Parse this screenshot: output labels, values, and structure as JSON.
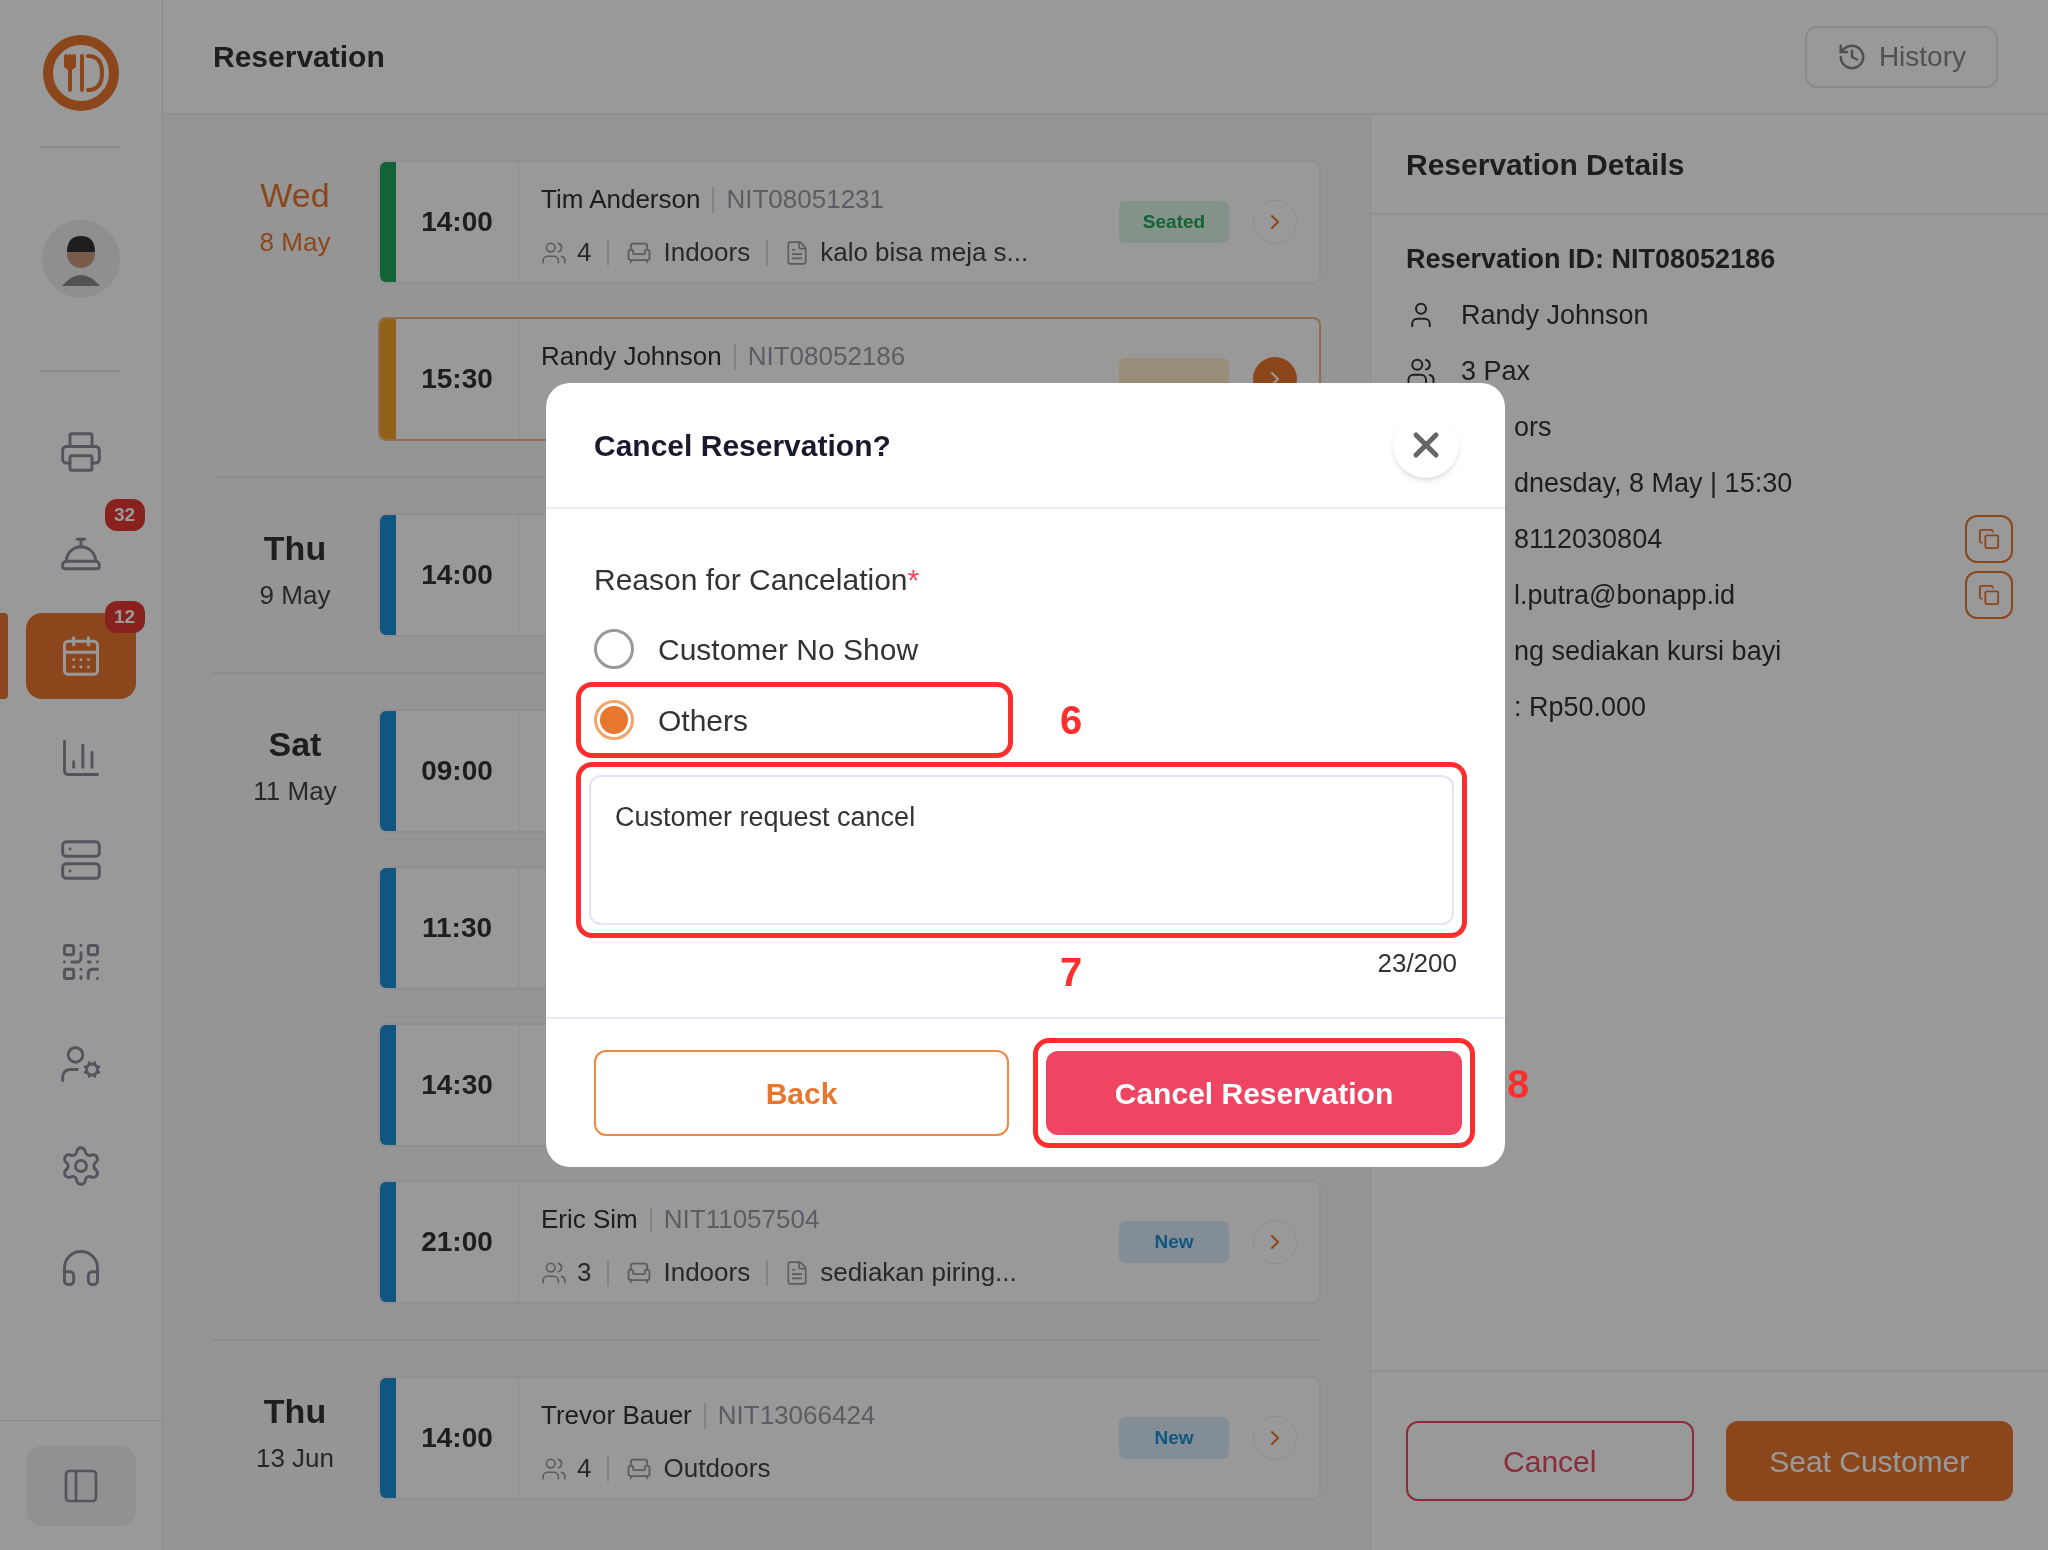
{
  "header": {
    "title": "Reservation",
    "history_button": "History"
  },
  "sidebar": {
    "items": [
      {
        "selected": false
      },
      {
        "badge": "32",
        "selected": false
      },
      {
        "badge": "12",
        "selected": true
      },
      {
        "selected": false
      },
      {
        "selected": false
      },
      {
        "selected": false
      },
      {
        "selected": false
      },
      {
        "selected": false
      },
      {
        "selected": false
      }
    ]
  },
  "days": [
    {
      "weekday": "Wed",
      "date": "8 May",
      "selected": true,
      "reservations": [
        {
          "time": "14:00",
          "kind": "seated",
          "selected": false,
          "name": "Tim Anderson",
          "id": "NIT08051231",
          "guests": "4",
          "seating": "Indoors",
          "note": "kalo bisa meja s...",
          "badge": "Seated"
        },
        {
          "time": "15:30",
          "kind": "accepted",
          "selected": true,
          "name": "Randy Johnson",
          "id": "NIT08052186"
        }
      ]
    },
    {
      "weekday": "Thu",
      "date": "9 May",
      "selected": false,
      "reservations": [
        {
          "time": "14:00",
          "kind": "new",
          "selected": false
        }
      ]
    },
    {
      "weekday": "Sat",
      "date": "11 May",
      "selected": false,
      "reservations": [
        {
          "time": "09:00",
          "kind": "new",
          "selected": false
        },
        {
          "time": "11:30",
          "kind": "new",
          "selected": false
        },
        {
          "time": "14:30",
          "kind": "new",
          "selected": false
        },
        {
          "time": "21:00",
          "kind": "new",
          "selected": false,
          "name": "Eric Sim",
          "id": "NIT11057504",
          "guests": "3",
          "seating": "Indoors",
          "note": "sediakan piring...",
          "badge": "New"
        }
      ]
    },
    {
      "weekday": "Thu",
      "date": "13 Jun",
      "selected": false,
      "reservations": [
        {
          "time": "14:00",
          "kind": "new",
          "selected": false,
          "name": "Trevor Bauer",
          "id": "NIT13066424",
          "guests": "4",
          "seating": "Outdoors",
          "badge": "New"
        }
      ]
    }
  ],
  "details": {
    "title": "Reservation Details",
    "reservation_id": "Reservation ID: NIT08052186",
    "rows": [
      {
        "kind": "person",
        "text": "Randy Johnson",
        "copy": false
      },
      {
        "kind": "guests",
        "text": "3 Pax",
        "copy": false
      },
      {
        "kind": "cut",
        "text": "ors",
        "copy": false
      },
      {
        "kind": "cut",
        "text": "dnesday, 8 May | 15:30",
        "copy": false
      },
      {
        "kind": "cut",
        "text": "8112030804",
        "copy": true
      },
      {
        "kind": "cut",
        "text": "l.putra@bonapp.id",
        "copy": true
      },
      {
        "kind": "cut",
        "text": "ng sediakan kursi bayi",
        "copy": false
      },
      {
        "kind": "cut",
        "text": ": Rp50.000",
        "copy": false
      }
    ],
    "cancel_button": "Cancel",
    "seat_button": "Seat Customer"
  },
  "modal": {
    "title": "Cancel Reservation?",
    "label": "Reason for Cancelation",
    "required_mark": "*",
    "options": [
      {
        "label": "Customer No Show",
        "selected": false
      },
      {
        "label": "Others",
        "selected": true,
        "callout": "6"
      }
    ],
    "reason": {
      "value": "Customer request cancel",
      "callout": "7"
    },
    "counter": "23/200",
    "back_button": "Back",
    "confirm_button": {
      "label": "Cancel Reservation",
      "callout": "8"
    }
  }
}
